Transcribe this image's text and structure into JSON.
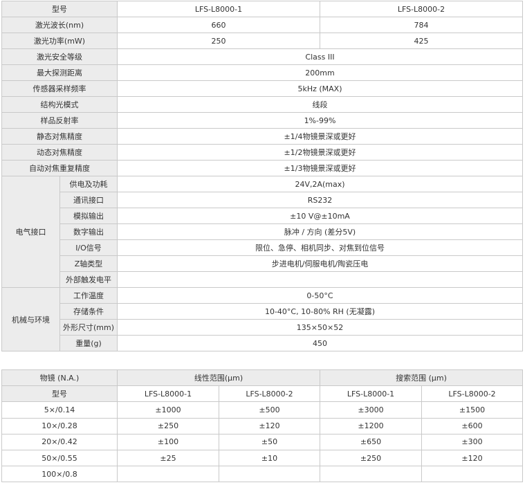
{
  "spec": {
    "model": {
      "label": "型号",
      "v1": "LFS-L8000-1",
      "v2": "LFS-L8000-2"
    },
    "wavelength": {
      "label": "激光波长(nm)",
      "v1": "660",
      "v2": "784"
    },
    "power": {
      "label": "激光功率(mW)",
      "v1": "250",
      "v2": "425"
    },
    "single_rows": [
      {
        "label": "激光安全等级",
        "value": "Class III"
      },
      {
        "label": "最大探测距离",
        "value": "200mm"
      },
      {
        "label": "传感器采样频率",
        "value": "5kHz (MAX)"
      },
      {
        "label": "结构光模式",
        "value": "线段"
      },
      {
        "label": "样品反射率",
        "value": "1%-99%"
      },
      {
        "label": "静态对焦精度",
        "value": "±1/4物镜景深或更好"
      },
      {
        "label": "动态对焦精度",
        "value": "±1/2物镜景深或更好"
      },
      {
        "label": "自动对焦重复精度",
        "value": "±1/3物镜景深或更好"
      }
    ],
    "electrical": {
      "group": "电气接口",
      "rows": [
        {
          "label": "供电及功耗",
          "value": "24V,2A(max)"
        },
        {
          "label": "通讯接口",
          "value": "RS232"
        },
        {
          "label": "模拟输出",
          "value": "±10 V@±10mA"
        },
        {
          "label": "数字输出",
          "value": "脉冲 / 方向 (差分5V)"
        },
        {
          "label": "I/O信号",
          "value": "限位、急停、相机同步、对焦到位信号"
        },
        {
          "label": "Z轴类型",
          "value": "步进电机/伺服电机/陶瓷压电"
        },
        {
          "label": "外部触发电平",
          "value": ""
        }
      ]
    },
    "environment": {
      "group": "机械与环境",
      "rows": [
        {
          "label": "工作温度",
          "value": "0-50°C"
        },
        {
          "label": "存储条件",
          "value": "10-40°C, 10-80% RH (无凝露)"
        },
        {
          "label": "外形尺寸(mm)",
          "value": "135×50×52"
        },
        {
          "label": "重量(g)",
          "value": "450"
        }
      ]
    }
  },
  "lens": {
    "header": {
      "objective": "物镜 (N.A.)",
      "linear": "线性范围(μm)",
      "search": "搜索范围 (μm)"
    },
    "subheader": {
      "model": "型号",
      "m1": "LFS-L8000-1",
      "m2": "LFS-L8000-2",
      "m3": "LFS-L8000-1",
      "m4": "LFS-L8000-2"
    },
    "rows": [
      {
        "obj": "5×/0.14",
        "l1": "±1000",
        "l2": "±500",
        "s1": "±3000",
        "s2": "±1500"
      },
      {
        "obj": "10×/0.28",
        "l1": "±250",
        "l2": "±120",
        "s1": "±1200",
        "s2": "±600"
      },
      {
        "obj": "20×/0.42",
        "l1": "±100",
        "l2": "±50",
        "s1": "±650",
        "s2": "±300"
      },
      {
        "obj": "50×/0.55",
        "l1": "±25",
        "l2": "±10",
        "s1": "±250",
        "s2": "±120"
      },
      {
        "obj": "100×/0.8",
        "l1": "",
        "l2": "",
        "s1": "",
        "s2": ""
      }
    ]
  }
}
